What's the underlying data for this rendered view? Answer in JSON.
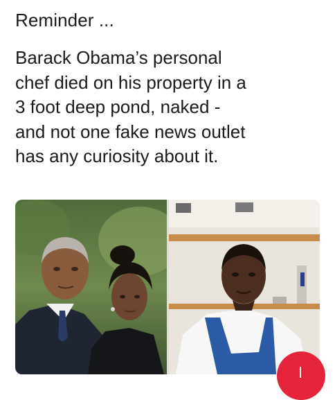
{
  "post": {
    "heading": "Reminder ...",
    "body_lines": [
      "Barack Obama’s personal",
      "chef died on his property in a",
      "3 foot deep pond, naked -",
      "and not one fake news outlet",
      "has any curiosity about it."
    ]
  },
  "images": [
    {
      "name": "photo-couple-outdoors"
    },
    {
      "name": "photo-man-in-kitchen-apron"
    }
  ],
  "colors": {
    "text": "#1a1a1a",
    "badge": "#e3243b",
    "apron": "#2b5aa6"
  }
}
